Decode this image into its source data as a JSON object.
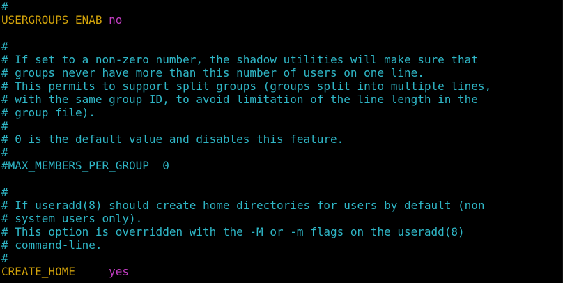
{
  "editor": {
    "colors": {
      "background": "#000000",
      "comment": "#2fb7c7",
      "key": "#d2a30b",
      "value": "#c33ec3"
    },
    "lines": [
      {
        "type": "comment",
        "text": "#"
      },
      {
        "type": "setting",
        "key": "USERGROUPS_ENAB",
        "sep": " ",
        "value": "no"
      },
      {
        "type": "blank",
        "text": ""
      },
      {
        "type": "comment",
        "text": "#"
      },
      {
        "type": "comment",
        "text": "# If set to a non-zero number, the shadow utilities will make sure that"
      },
      {
        "type": "comment",
        "text": "# groups never have more than this number of users on one line."
      },
      {
        "type": "comment",
        "text": "# This permits to support split groups (groups split into multiple lines,"
      },
      {
        "type": "comment",
        "text": "# with the same group ID, to avoid limitation of the line length in the"
      },
      {
        "type": "comment",
        "text": "# group file)."
      },
      {
        "type": "comment",
        "text": "#"
      },
      {
        "type": "comment",
        "text": "# 0 is the default value and disables this feature."
      },
      {
        "type": "comment",
        "text": "#"
      },
      {
        "type": "comment",
        "text": "#MAX_MEMBERS_PER_GROUP  0"
      },
      {
        "type": "blank",
        "text": ""
      },
      {
        "type": "comment",
        "text": "#"
      },
      {
        "type": "comment",
        "text": "# If useradd(8) should create home directories for users by default (non"
      },
      {
        "type": "comment",
        "text": "# system users only)."
      },
      {
        "type": "comment",
        "text": "# This option is overridden with the -M or -m flags on the useradd(8)"
      },
      {
        "type": "comment",
        "text": "# command-line."
      },
      {
        "type": "comment",
        "text": "#"
      },
      {
        "type": "setting",
        "key": "CREATE_HOME",
        "sep": "     ",
        "value": "yes"
      }
    ]
  }
}
